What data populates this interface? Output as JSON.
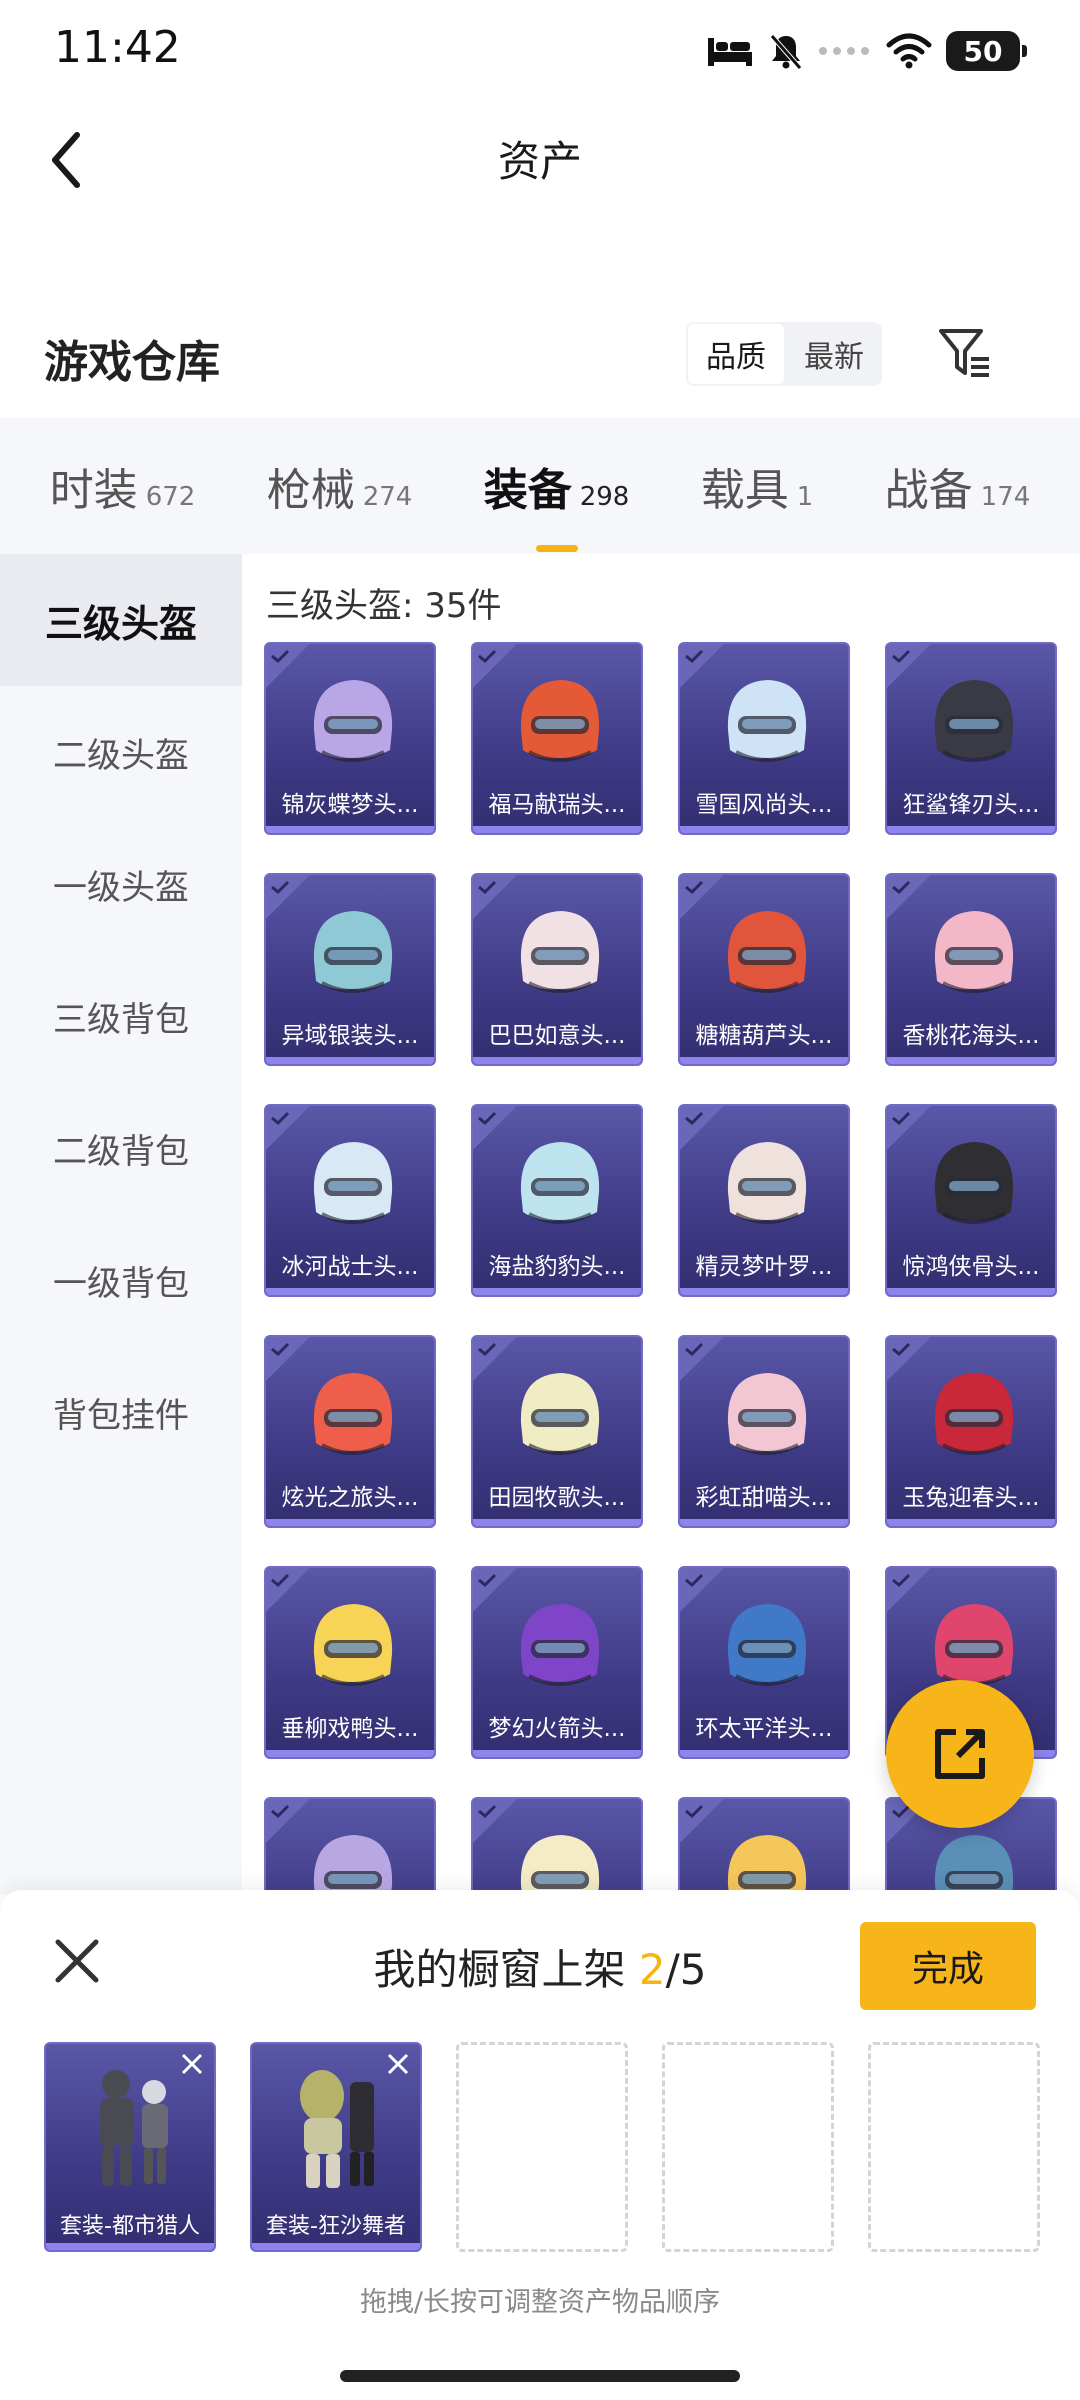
{
  "status_bar": {
    "time": "11:42",
    "battery": "50"
  },
  "header": {
    "title": "资产"
  },
  "section": {
    "title": "游戏仓库",
    "sort_options": [
      "品质",
      "最新"
    ]
  },
  "tabs": [
    {
      "label": "时装",
      "count": "672"
    },
    {
      "label": "枪械",
      "count": "274"
    },
    {
      "label": "装备",
      "count": "298"
    },
    {
      "label": "载具",
      "count": "1"
    },
    {
      "label": "战备",
      "count": "174"
    }
  ],
  "sidebar": {
    "items": [
      {
        "label": "三级头盔"
      },
      {
        "label": "二级头盔"
      },
      {
        "label": "一级头盔"
      },
      {
        "label": "三级背包"
      },
      {
        "label": "二级背包"
      },
      {
        "label": "一级背包"
      },
      {
        "label": "背包挂件"
      }
    ]
  },
  "content": {
    "count_label": "三级头盔: 35件",
    "items": [
      {
        "name": "锦灰蝶梦头...",
        "color": "#b8a6e6"
      },
      {
        "name": "福马献瑞头...",
        "color": "#e55a36"
      },
      {
        "name": "雪国风尚头...",
        "color": "#cfe3f7"
      },
      {
        "name": "狂鲨锋刃头...",
        "color": "#3a3a44"
      },
      {
        "name": "异域银装头...",
        "color": "#8fc9d6"
      },
      {
        "name": "巴巴如意头...",
        "color": "#f2e1e4"
      },
      {
        "name": "糖糖葫芦头...",
        "color": "#e0553c"
      },
      {
        "name": "香桃花海头...",
        "color": "#f4b7c8"
      },
      {
        "name": "冰河战士头...",
        "color": "#d9e8f5"
      },
      {
        "name": "海盐豹豹头...",
        "color": "#bde3ef"
      },
      {
        "name": "精灵梦叶罗...",
        "color": "#efe2dc"
      },
      {
        "name": "惊鸿侠骨头...",
        "color": "#2f2f33"
      },
      {
        "name": "炫光之旅头...",
        "color": "#ee5e4a"
      },
      {
        "name": "田园牧歌头...",
        "color": "#f0ecc3"
      },
      {
        "name": "彩虹甜喵头...",
        "color": "#f3c6d3"
      },
      {
        "name": "玉兔迎春头...",
        "color": "#c9283a"
      },
      {
        "name": "垂柳戏鸭头...",
        "color": "#f7d356"
      },
      {
        "name": "梦幻火箭头...",
        "color": "#7e45c9"
      },
      {
        "name": "环太平洋头...",
        "color": "#3f79c8"
      },
      {
        "name": "",
        "color": "#e0466d"
      },
      {
        "name": "",
        "color": "#b9a7e3"
      },
      {
        "name": "",
        "color": "#f3ecc7"
      },
      {
        "name": "",
        "color": "#f5c65a"
      },
      {
        "name": "",
        "color": "#5a8fb8"
      }
    ]
  },
  "showcase": {
    "title_prefix": "我的橱窗上架 ",
    "current": "2",
    "total": "/5",
    "done_label": "完成",
    "slots": [
      {
        "name": "套装-都市猎人",
        "color": "#4a4a52"
      },
      {
        "name": "套装-狂沙舞者",
        "color": "#b5b36a"
      }
    ],
    "hint": "拖拽/长按可调整资产物品顺序"
  },
  "colors": {
    "accent": "#f8b519",
    "card_bg": "#3e3a85",
    "card_bar": "#8f84ee"
  }
}
